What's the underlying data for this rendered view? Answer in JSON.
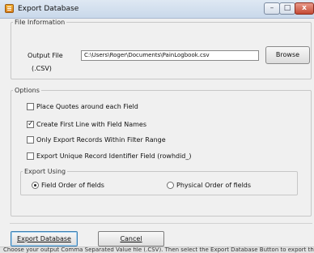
{
  "window": {
    "title": "Export Database",
    "icon": "database-export-icon",
    "controls": {
      "minimize": "–",
      "maximize": "□",
      "close": "x"
    }
  },
  "file_info": {
    "legend": "File Information",
    "output_label": "Output File",
    "output_value": "C:\\Users\\Roger\\Documents\\PainLogbook.csv",
    "type_label": "(.CSV)",
    "browse_label": "Browse"
  },
  "options": {
    "legend": "Options",
    "checkboxes": [
      {
        "label": "Place Quotes around each Field",
        "checked": false
      },
      {
        "label": "Create First Line with Field Names",
        "checked": true
      },
      {
        "label": "Only Export Records Within Filter Range",
        "checked": false
      },
      {
        "label": "Export Unique Record Identifier Field (rowhdid_)",
        "checked": false
      }
    ],
    "export_using": {
      "legend": "Export Using",
      "radios": [
        {
          "label": "Field Order of fields",
          "selected": true
        },
        {
          "label": "Physical Order of fields",
          "selected": false
        }
      ]
    }
  },
  "buttons": {
    "export_label": "Export Database",
    "cancel_label": "Cancel"
  },
  "status": {
    "text": "Choose your output Comma Separated Value file (.CSV). Then select the Export Database Button to export the"
  }
}
